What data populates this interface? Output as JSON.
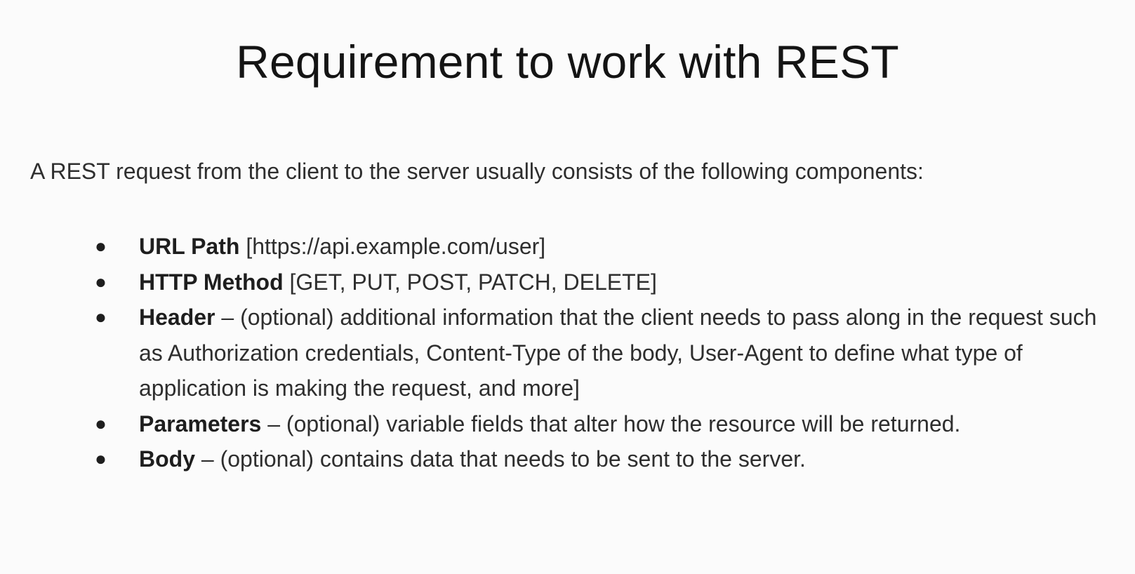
{
  "slide": {
    "title": "Requirement to work with REST",
    "intro": "A REST request from the client to the server usually consists of the following components:",
    "items": [
      {
        "term": "URL Path",
        "description": " [https://api.example.com/user]"
      },
      {
        "term": "HTTP Method",
        "description": " [GET, PUT, POST, PATCH, DELETE]"
      },
      {
        "term": "Header",
        "description": " – (optional) additional information that the client needs to pass along in the request such as Authorization credentials, Content-Type of the body, User-Agent to define what type of application is making the request, and more]"
      },
      {
        "term": "Parameters",
        "description": " – (optional) variable fields that alter how the resource will be returned."
      },
      {
        "term": "Body",
        "description": " – (optional) contains data that needs to be sent to the server."
      }
    ],
    "bullet_glyph": "●",
    "colors": {
      "background": "#fbfbfb",
      "title": "#141414",
      "text": "#2e2e2e"
    }
  }
}
